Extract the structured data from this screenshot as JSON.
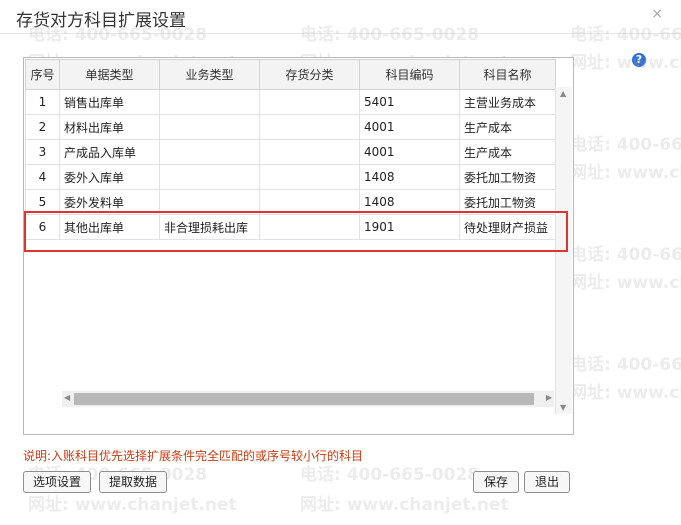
{
  "dialog": {
    "title": "存货对方科目扩展设置",
    "close_glyph": "×",
    "help_glyph": "?"
  },
  "watermark": {
    "phone": "电话: 400-665-0028",
    "site": "网址: www.chanjet.net"
  },
  "grid": {
    "columns": [
      "序号",
      "单据类型",
      "业务类型",
      "存货分类",
      "科目编码",
      "科目名称"
    ],
    "rows": [
      [
        "1",
        "销售出库单",
        "",
        "",
        "5401",
        "主营业务成本"
      ],
      [
        "2",
        "材料出库单",
        "",
        "",
        "4001",
        "生产成本"
      ],
      [
        "3",
        "产成品入库单",
        "",
        "",
        "4001",
        "生产成本"
      ],
      [
        "4",
        "委外入库单",
        "",
        "",
        "1408",
        "委托加工物资"
      ],
      [
        "5",
        "委外发料单",
        "",
        "",
        "1408",
        "委托加工物资"
      ],
      [
        "6",
        "其他出库单",
        "非合理损耗出库",
        "",
        "1901",
        "待处理财产损益"
      ]
    ]
  },
  "note": "说明:入账科目优先选择扩展条件完全匹配的或序号较小行的科目",
  "buttons": {
    "options": "选项设置",
    "fetch": "提取数据",
    "save": "保存",
    "exit": "退出"
  },
  "colors": {
    "highlight": "#e03434",
    "note": "#c83c14",
    "help": "#2f6fd6"
  }
}
